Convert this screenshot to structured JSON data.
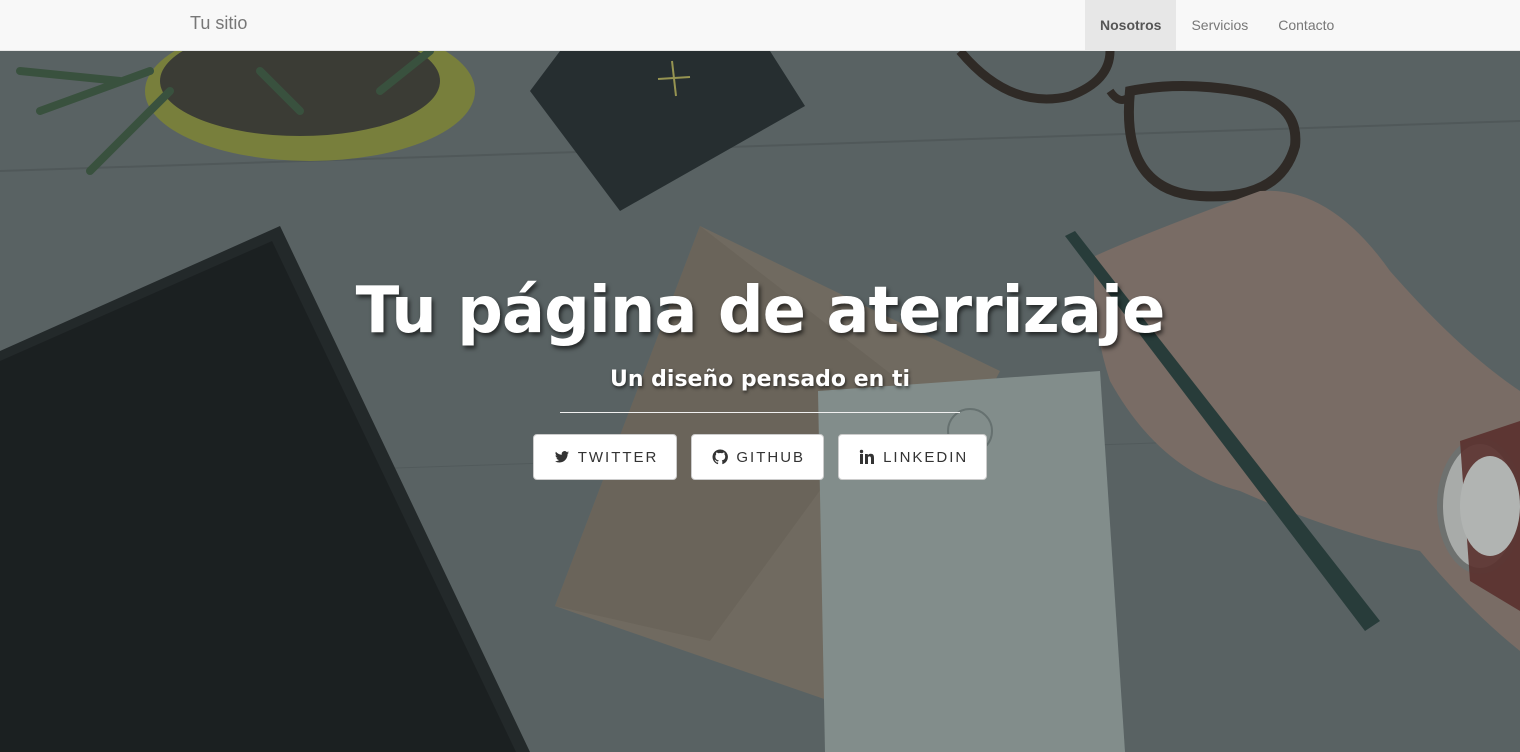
{
  "navbar": {
    "brand": "Tu sitio",
    "items": [
      {
        "label": "Nosotros",
        "active": true
      },
      {
        "label": "Servicios",
        "active": false
      },
      {
        "label": "Contacto",
        "active": false
      }
    ]
  },
  "hero": {
    "title": "Tu página de aterrizaje",
    "subtitle": "Un diseño pensado en ti",
    "buttons": [
      {
        "label": "TWITTER",
        "icon": "twitter-icon"
      },
      {
        "label": "GITHUB",
        "icon": "github-icon"
      },
      {
        "label": "LINKEDIN",
        "icon": "linkedin-icon"
      }
    ]
  },
  "colors": {
    "navbar_bg": "#f8f8f8",
    "nav_active_bg": "#e7e7e7",
    "hero_overlay": "#4f5658"
  }
}
